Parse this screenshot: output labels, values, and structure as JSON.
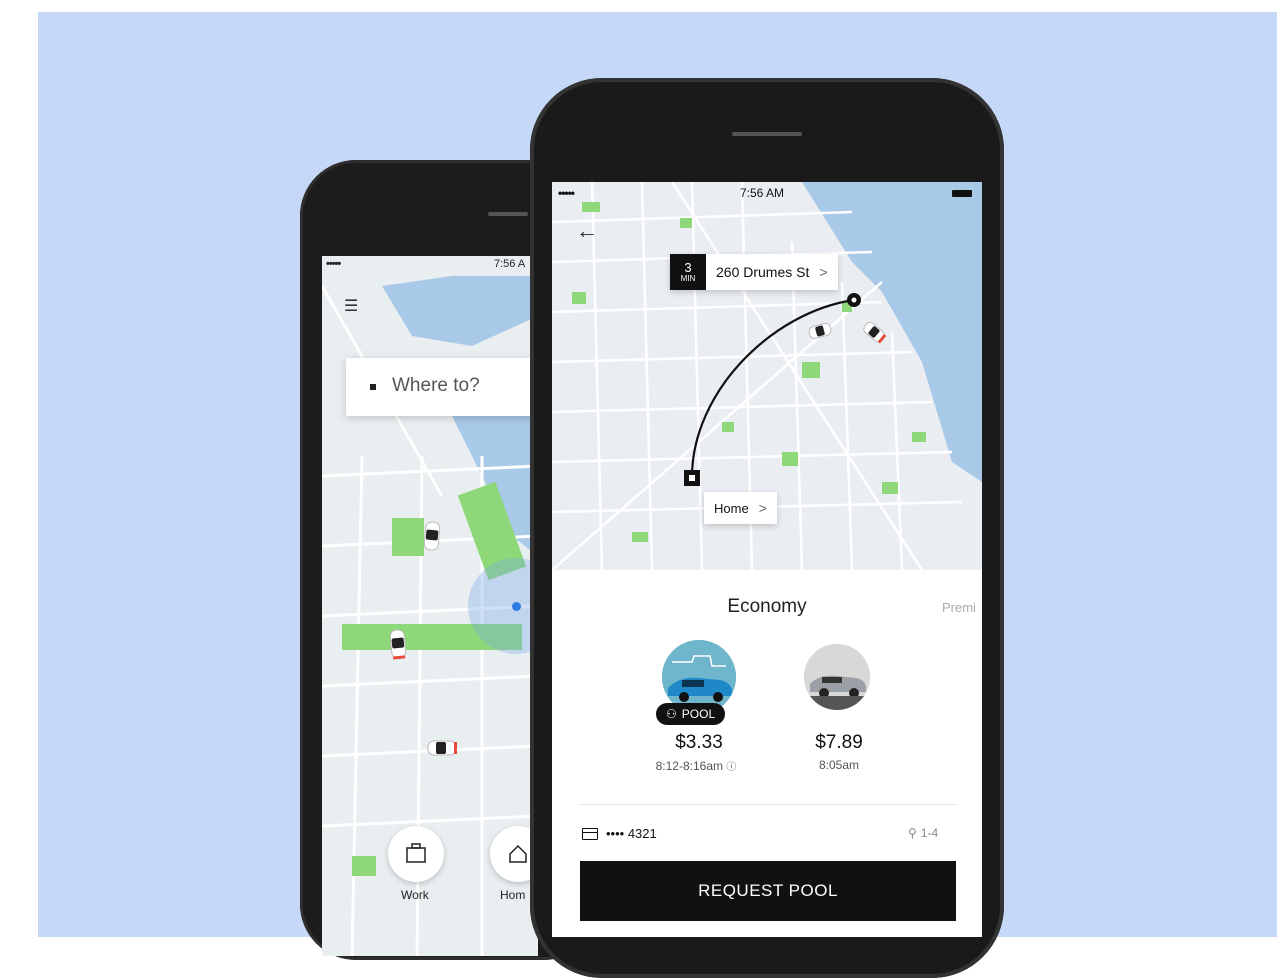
{
  "back_phone": {
    "status_time": "7:56 A",
    "status_dots": "•••••",
    "search_placeholder": "Where to?",
    "shortcuts": [
      {
        "label": "Work",
        "icon": "briefcase-icon"
      },
      {
        "label": "Hom",
        "icon": "home-icon"
      }
    ]
  },
  "front_phone": {
    "status_time": "7:56 AM",
    "status_dots": "•••••",
    "pickup": {
      "eta_value": "3",
      "eta_unit": "MIN",
      "address": "260 Drumes St"
    },
    "dropoff": {
      "label": "Home"
    },
    "tier": {
      "title": "Economy",
      "next": "Premi"
    },
    "options": [
      {
        "badge": "POOL",
        "price": "$3.33",
        "time": "8:12-8:16am"
      },
      {
        "price": "$7.89",
        "time": "8:05am"
      }
    ],
    "payment": {
      "card": "•••• 4321",
      "seats": "1-4"
    },
    "request_button": "REQUEST POOL"
  },
  "colors": {
    "background": "#c5d8f7",
    "map_green": "#8fd87a",
    "water": "#a9c9e8",
    "button": "#111111"
  }
}
